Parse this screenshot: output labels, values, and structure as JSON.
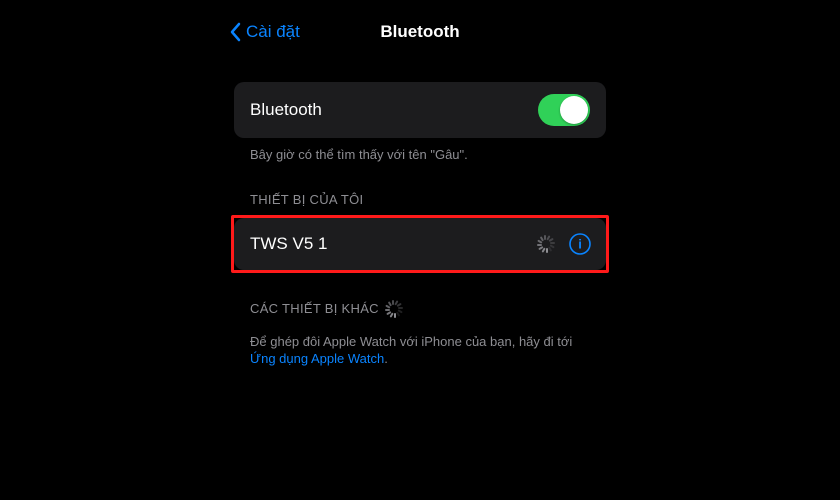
{
  "nav": {
    "back_label": "Cài đặt",
    "title": "Bluetooth"
  },
  "bluetooth_row": {
    "label": "Bluetooth",
    "enabled": true
  },
  "discoverable_text": "Bây giờ có thể tìm thấy với tên \"Gâu\".",
  "my_devices_header": "THIẾT BỊ CỦA TÔI",
  "my_devices": [
    {
      "name": "TWS V5 1",
      "connecting": true
    }
  ],
  "other_devices_header": "CÁC THIẾT BỊ KHÁC",
  "watch_hint_prefix": "Để ghép đôi Apple Watch với iPhone của bạn, hãy đi tới ",
  "watch_hint_link": "Ứng dụng Apple Watch",
  "watch_hint_suffix": "."
}
